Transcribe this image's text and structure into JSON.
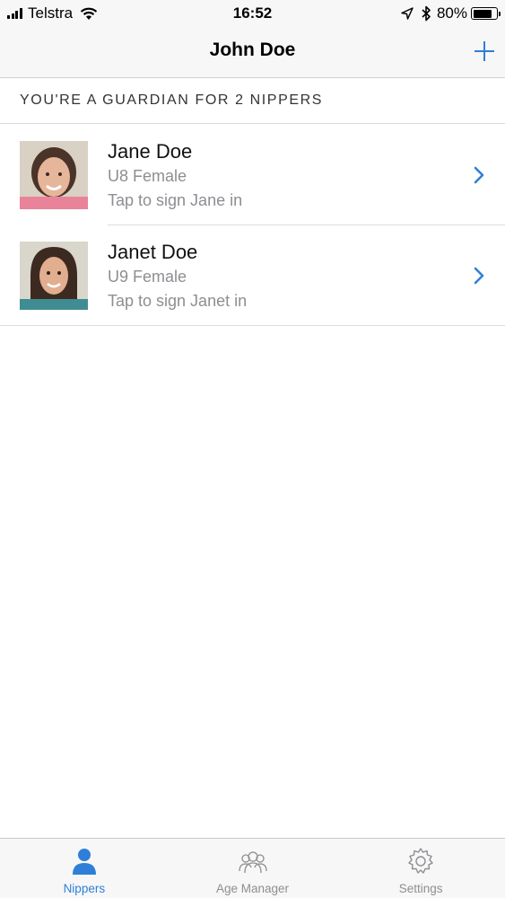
{
  "status_bar": {
    "carrier": "Telstra",
    "time": "16:52",
    "battery_percent": "80%",
    "battery_level": 0.8
  },
  "nav": {
    "title": "John Doe",
    "add_icon": "plus-icon"
  },
  "section": {
    "header": "YOU'RE A GUARDIAN FOR 2 NIPPERS"
  },
  "nippers": [
    {
      "name": "Jane Doe",
      "category": "U8 Female",
      "hint": "Tap to sign Jane in"
    },
    {
      "name": "Janet Doe",
      "category": "U9 Female",
      "hint": "Tap to sign Janet in"
    }
  ],
  "tabs": [
    {
      "label": "Nippers",
      "icon": "person-icon",
      "active": true
    },
    {
      "label": "Age Manager",
      "icon": "group-icon",
      "active": false
    },
    {
      "label": "Settings",
      "icon": "gear-icon",
      "active": false
    }
  ],
  "colors": {
    "accent": "#2f7fd8",
    "secondary_text": "#8e8e93",
    "bar_background": "#f7f7f7"
  }
}
